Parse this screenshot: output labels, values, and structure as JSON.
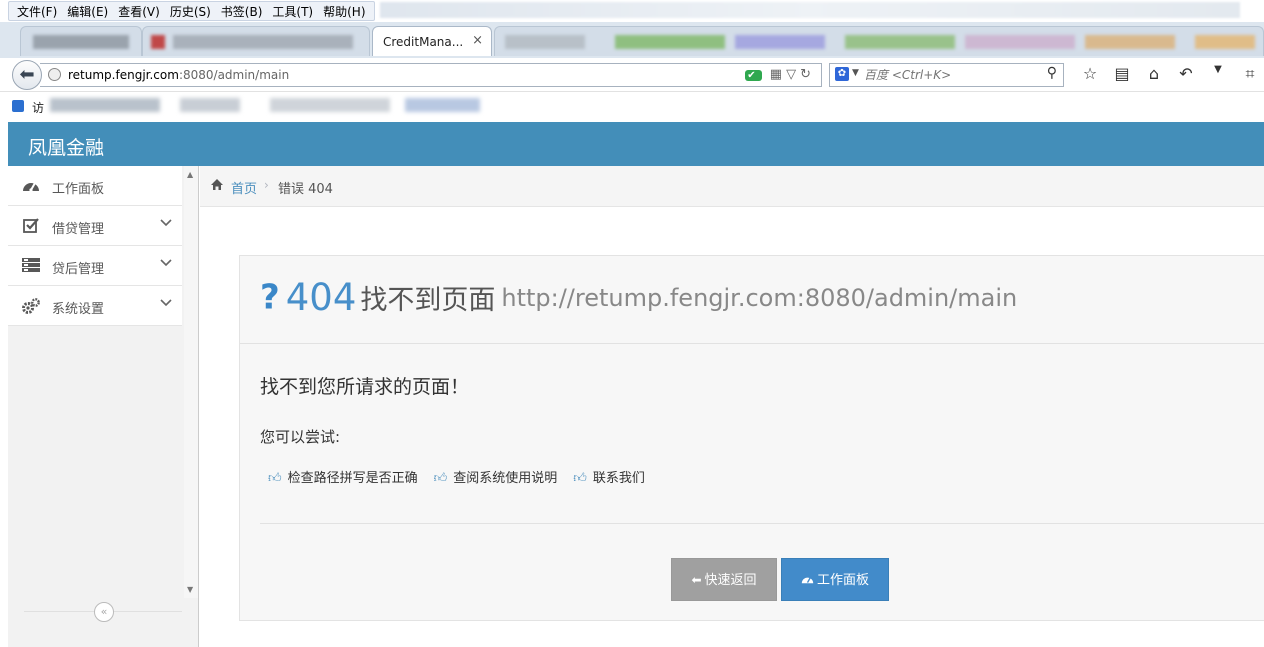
{
  "browser": {
    "menu": [
      "文件(F)",
      "编辑(E)",
      "查看(V)",
      "历史(S)",
      "书签(B)",
      "工具(T)",
      "帮助(H)"
    ],
    "tabs": [
      {
        "label": "",
        "active": false
      },
      {
        "label": "",
        "active": false
      },
      {
        "label": "CreditMana...",
        "active": true
      },
      {
        "label": "",
        "active": false
      }
    ],
    "tab_close": "×",
    "url_host": "retump.fengjr.com",
    "url_rest": ":8080/admin/main",
    "search_placeholder": "百度 <Ctrl+K>",
    "bookmark_label": "访"
  },
  "app": {
    "brand": "凤凰金融",
    "sidebar": {
      "items": [
        {
          "label": "工作面板",
          "icon": "dashboard-icon",
          "expandable": false
        },
        {
          "label": "借贷管理",
          "icon": "check-square-icon",
          "expandable": true
        },
        {
          "label": "贷后管理",
          "icon": "list-icon",
          "expandable": true
        },
        {
          "label": "系统设置",
          "icon": "cogs-icon",
          "expandable": true
        }
      ],
      "collapse_glyph": "«"
    },
    "breadcrumb": {
      "home": "首页",
      "separator": "›",
      "current": "错误 404"
    }
  },
  "error": {
    "code": "404",
    "title": "找不到页面",
    "path": "http://retump.fengjr.com:8080/admin/main",
    "message": "找不到您所请求的页面！",
    "try_label": "您可以尝试:",
    "suggestions": [
      "检查路径拼写是否正确",
      "查阅系统使用说明",
      "联系我们"
    ],
    "back_button": "快速返回",
    "dashboard_button": "工作面板"
  },
  "colors": {
    "header": "#438eb9",
    "accent": "#478fca",
    "button_primary": "#428bca",
    "button_grey": "#a0a0a0"
  }
}
